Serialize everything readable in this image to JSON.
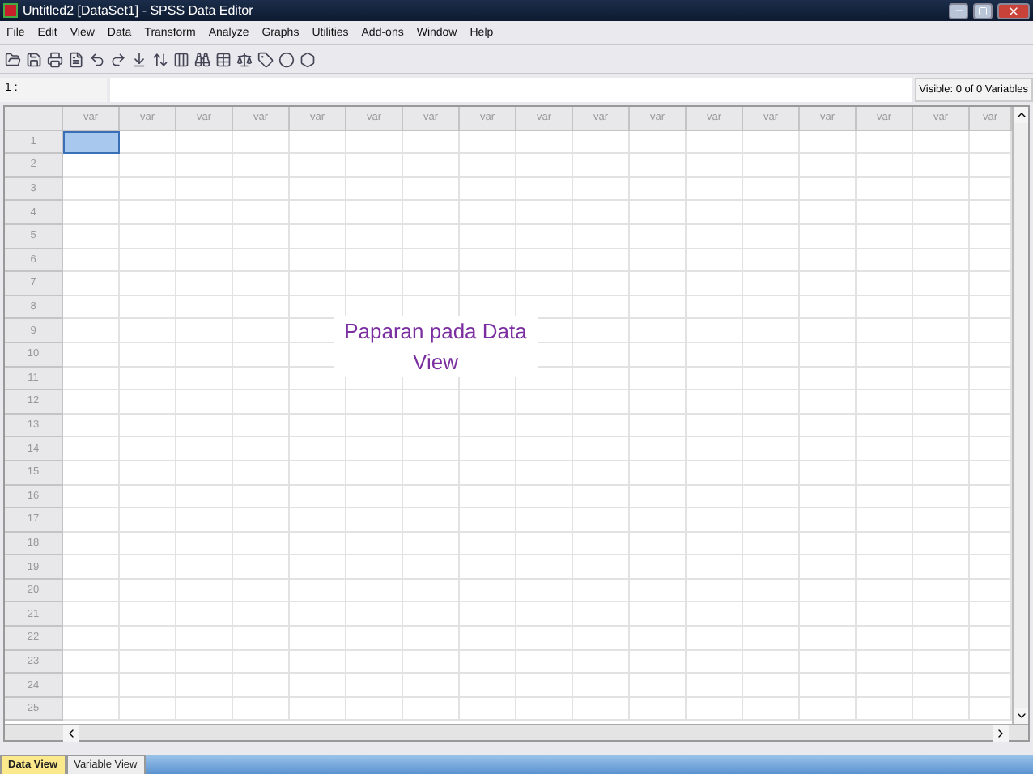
{
  "window": {
    "title": "Untitled2 [DataSet1] - SPSS Data Editor"
  },
  "menu": [
    "File",
    "Edit",
    "View",
    "Data",
    "Transform",
    "Analyze",
    "Graphs",
    "Utilities",
    "Add-ons",
    "Window",
    "Help"
  ],
  "cell_ref": {
    "label": "1 :"
  },
  "visible_info": "Visible: 0 of 0 Variables",
  "columns": [
    "var",
    "var",
    "var",
    "var",
    "var",
    "var",
    "var",
    "var",
    "var",
    "var",
    "var",
    "var",
    "var",
    "var",
    "var",
    "var",
    "var"
  ],
  "rows": [
    "1",
    "2",
    "3",
    "4",
    "5",
    "6",
    "7",
    "8",
    "9",
    "10",
    "11",
    "12",
    "13",
    "14",
    "15",
    "16",
    "17",
    "18",
    "19",
    "20",
    "21",
    "22",
    "23",
    "24",
    "25"
  ],
  "annotation": "Paparan pada Data View",
  "tabs": [
    {
      "label": "Data View",
      "selected": true
    },
    {
      "label": "Variable View",
      "selected": false
    }
  ]
}
